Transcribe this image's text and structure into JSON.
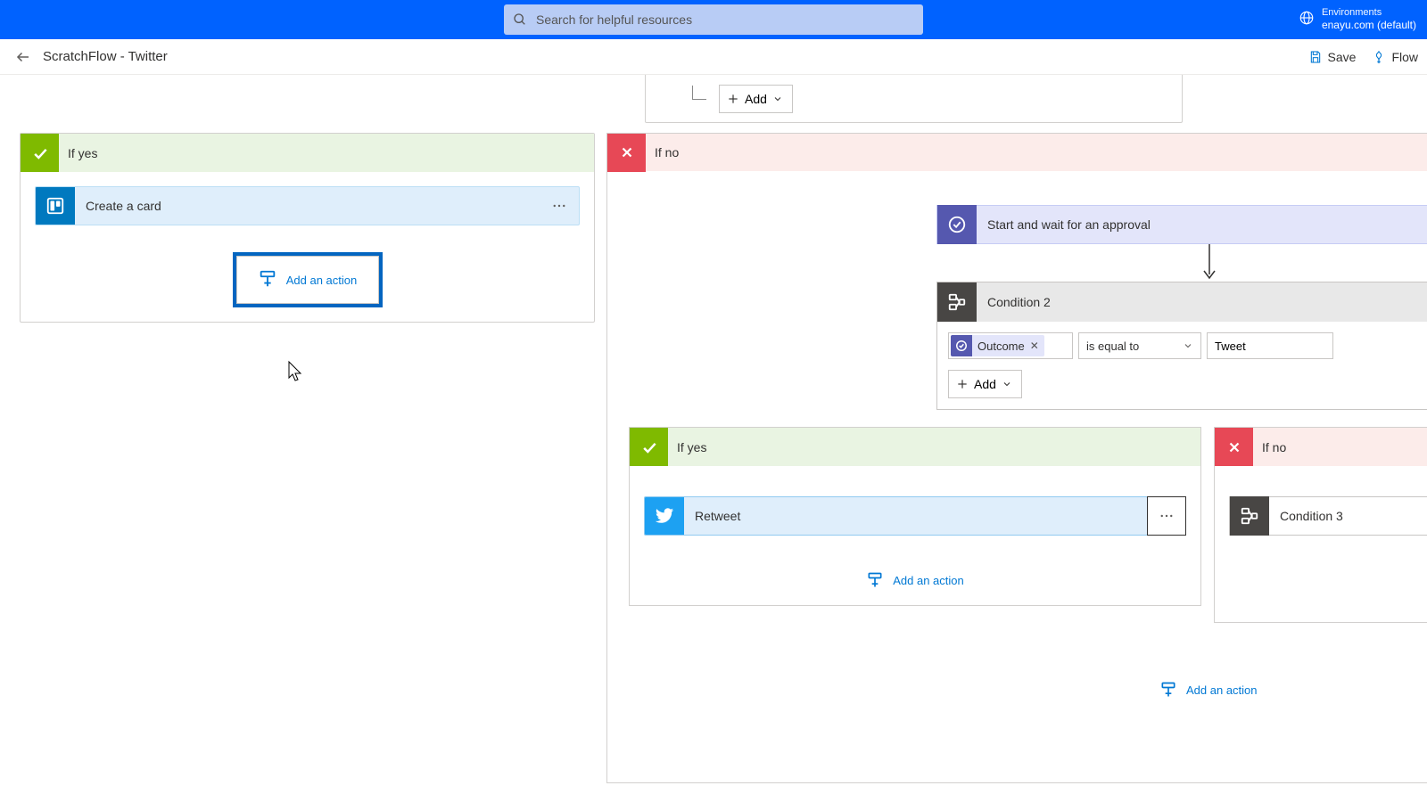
{
  "topbar": {
    "search_placeholder": "Search for helpful resources",
    "env_label": "Environments",
    "env_value": "enayu.com (default)"
  },
  "cmdbar": {
    "title": "ScratchFlow - Twitter",
    "save": "Save",
    "flow": "Flow"
  },
  "top_partial": {
    "add": "Add"
  },
  "left_branch": {
    "title": "If yes",
    "action1": "Create a card",
    "add_action": "Add an action"
  },
  "right_branch": {
    "title": "If no",
    "approval": "Start and wait for an approval",
    "cond2": {
      "title": "Condition 2",
      "token": "Outcome",
      "operator": "is equal to",
      "value": "Tweet",
      "add": "Add"
    },
    "nested_yes": {
      "title": "If yes",
      "action": "Retweet",
      "add": "Add an action"
    },
    "nested_no": {
      "title": "If no",
      "cond3": "Condition 3"
    },
    "add_action_lower": "Add an action"
  }
}
